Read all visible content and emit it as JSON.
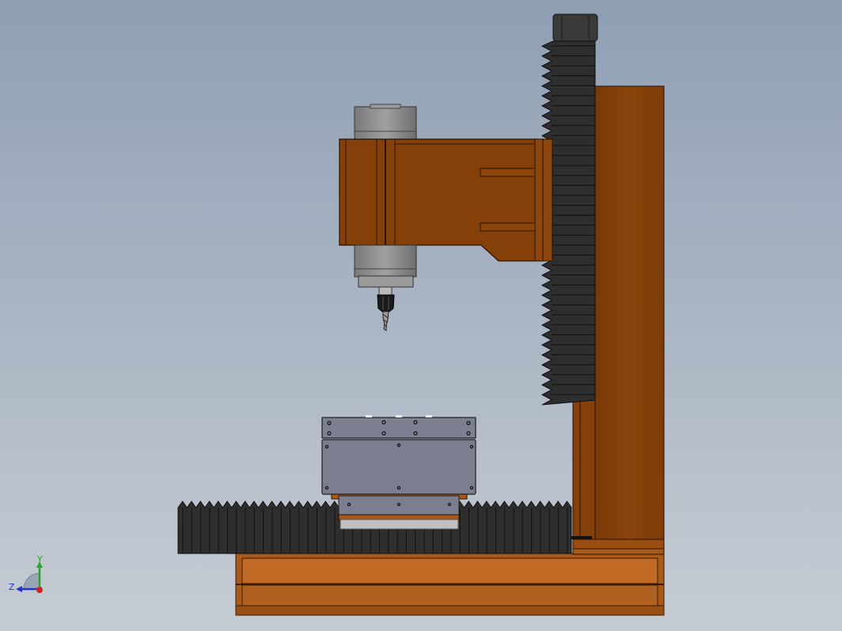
{
  "viewport": {
    "view": "cad-3d-viewport",
    "model": "cnc-milling-machine-side-view"
  },
  "colors": {
    "frame_orange": "#85400a",
    "frame_orange_light": "#b8621f",
    "bellows_dark": "#2e2e2e",
    "table_gray": "#7a7e8e",
    "spindle_gray": "#8e8e8e",
    "background_top": "#8f9fb3",
    "background_bottom": "#c6ccd3"
  },
  "triad": {
    "y_label": "Y",
    "z_label": "Z",
    "y_color": "#22aa22",
    "z_color": "#2233cc",
    "x_color": "#cc2222"
  }
}
